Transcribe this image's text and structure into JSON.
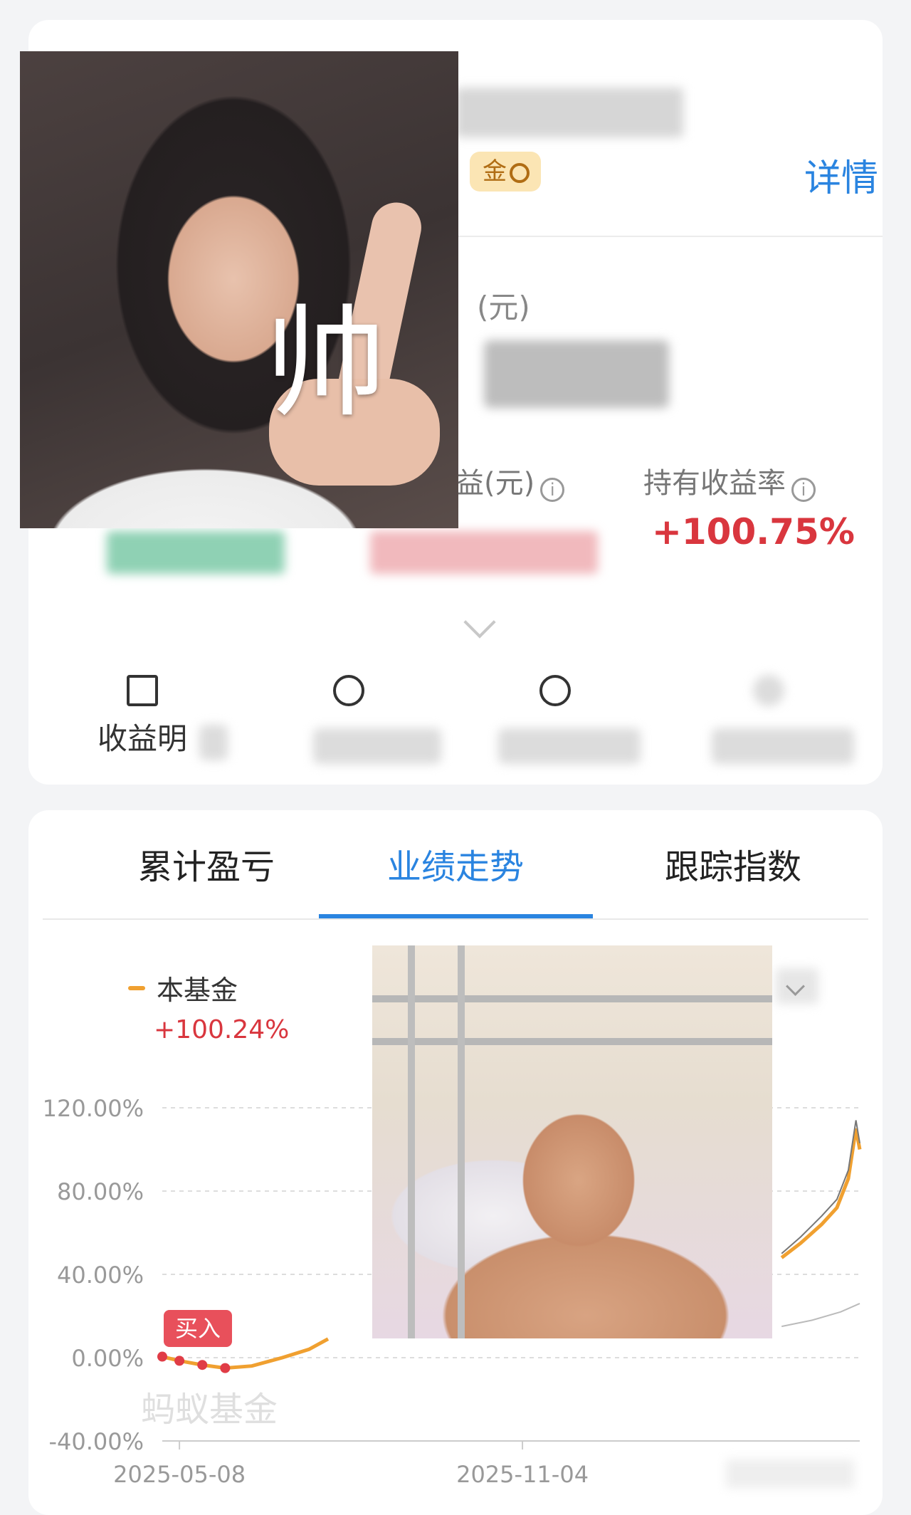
{
  "header": {
    "detail_label": "详情",
    "badge_text": "金"
  },
  "summary": {
    "asset_label": "(元)",
    "metrics": [
      {
        "label": "益(元)",
        "value": ""
      },
      {
        "label": "持有收益率",
        "value": "+100.75%"
      }
    ]
  },
  "quick_actions": [
    {
      "label": "收益明"
    },
    {
      "label": ""
    },
    {
      "label": ""
    },
    {
      "label": ""
    }
  ],
  "overlay": {
    "character": "帅"
  },
  "tabs": [
    {
      "label": "累计盈亏"
    },
    {
      "label": "业绩走势"
    },
    {
      "label": "跟踪指数"
    }
  ],
  "legend": {
    "name": "本基金",
    "value": "+100.24%"
  },
  "watermark": "蚂蚁基金",
  "buy_tag": "买入",
  "colors": {
    "accent": "#2a84e0",
    "fund_line": "#f0a030",
    "gain": "#d9363e",
    "benchmark": "#777777"
  },
  "chart_data": {
    "type": "line",
    "y_ticks": [
      "120.00%",
      "80.00%",
      "40.00%",
      "0.00%",
      "-40.00%"
    ],
    "x_ticks": [
      "2025-05-08",
      "2025-11-04"
    ],
    "ylim": [
      -40,
      120
    ],
    "grid": true,
    "series": [
      {
        "name": "本基金",
        "color": "#f0a030",
        "points": [
          [
            "2025-04-29",
            0.5
          ],
          [
            "2025-05-08",
            -1.5
          ],
          [
            "2025-05-20",
            -3.5
          ],
          [
            "2025-06-01",
            -5
          ],
          [
            "2025-06-15",
            -4
          ],
          [
            "2025-07-01",
            0
          ],
          [
            "2025-07-15",
            4
          ],
          [
            "2025-07-25",
            9
          ]
        ]
      },
      {
        "name": "",
        "color": "#f0a030",
        "points": [
          [
            "2026-03-20",
            48
          ],
          [
            "2026-03-30",
            55
          ],
          [
            "2026-04-10",
            64
          ],
          [
            "2026-04-18",
            72
          ],
          [
            "2026-04-24",
            86
          ],
          [
            "2026-04-28",
            110
          ],
          [
            "2026-04-30",
            100
          ]
        ]
      },
      {
        "name": "",
        "color": "#777777",
        "points": [
          [
            "2026-03-20",
            50
          ],
          [
            "2026-03-30",
            58
          ],
          [
            "2026-04-10",
            68
          ],
          [
            "2026-04-18",
            76
          ],
          [
            "2026-04-24",
            90
          ],
          [
            "2026-04-28",
            114
          ],
          [
            "2026-04-30",
            103
          ]
        ]
      },
      {
        "name": "",
        "color": "#bbbbbb",
        "points": [
          [
            "2026-03-20",
            15
          ],
          [
            "2026-04-05",
            18
          ],
          [
            "2026-04-20",
            22
          ],
          [
            "2026-04-30",
            26
          ]
        ]
      }
    ]
  }
}
